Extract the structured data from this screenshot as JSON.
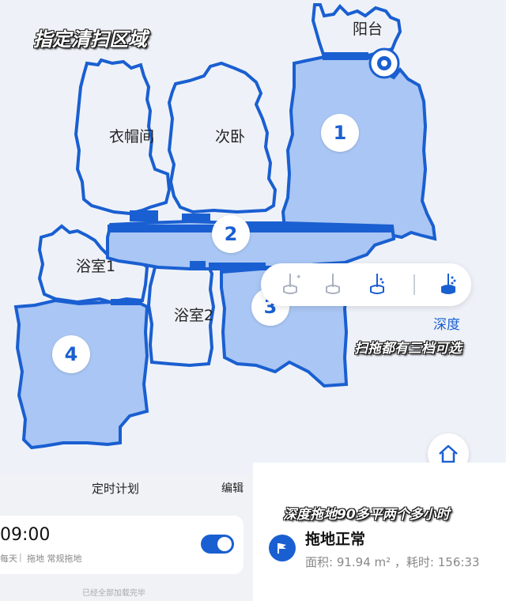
{
  "captions": {
    "title": "指定清扫区域",
    "mop_tiers": "扫拖都有三档可选",
    "result": "深度拖地90多平两个多小时"
  },
  "rooms": {
    "balcony": "阳台",
    "closet": "衣帽间",
    "second_bedroom": "次卧",
    "bath1": "浴室1",
    "bath2": "浴室2"
  },
  "zones": [
    "1",
    "2",
    "3",
    "4"
  ],
  "mop_selector": {
    "icons": [
      "mop-sparkle-icon",
      "mop-light-icon",
      "mop-standard-icon",
      "mop-deep-icon"
    ],
    "selected_label": "深度"
  },
  "schedule": {
    "title": "定时计划",
    "edit": "编辑",
    "time": "09:00",
    "repeat": "每天",
    "mode": "拖地 常规拖地",
    "footer": "已经全部加载完毕"
  },
  "status": {
    "title": "拖地正常",
    "detail": "面积: 91.94 m² ，耗时: 156:33"
  },
  "colors": {
    "accent": "#1a5fd1",
    "room_fill_selected": "#a9c6f4",
    "room_fill": "#eef2f8"
  }
}
